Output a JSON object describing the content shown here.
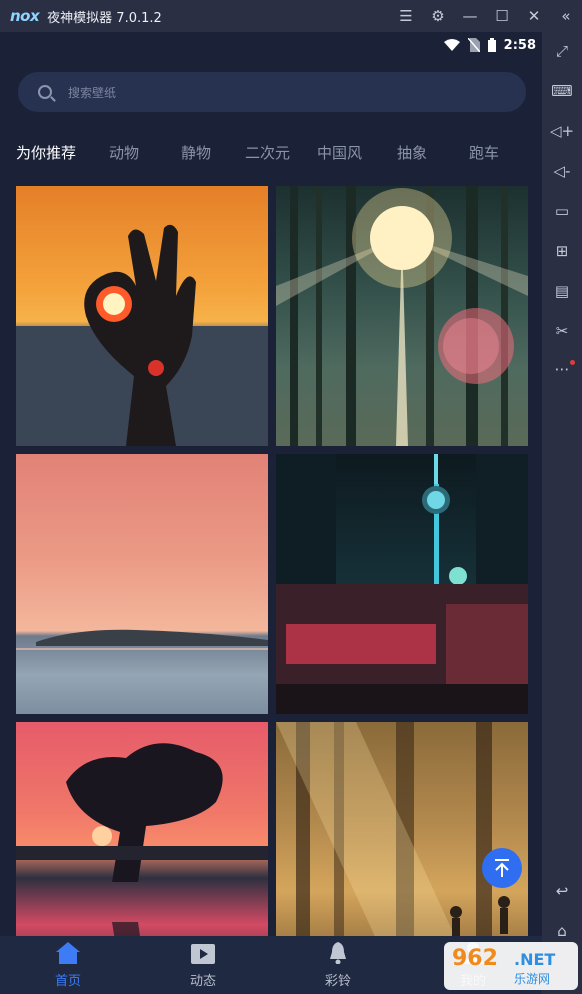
{
  "window": {
    "logo": "nox",
    "title": "夜神模拟器 7.0.1.2",
    "controls": [
      "menu-icon",
      "gear-icon",
      "minimize-icon",
      "maximize-icon",
      "close-icon",
      "collapse-icon"
    ]
  },
  "sidebar": {
    "items": [
      "fullscreen-icon",
      "keyboard-icon",
      "volume-up-icon",
      "volume-down-icon",
      "screen-icon",
      "apk-install-icon",
      "clear-cache-icon",
      "scissors-icon",
      "more-icon",
      "back-icon",
      "home-icon"
    ]
  },
  "status_bar": {
    "time": "2:58"
  },
  "search": {
    "placeholder": "搜索壁纸"
  },
  "categories": [
    {
      "label": "为你推荐",
      "active": true
    },
    {
      "label": "动物",
      "active": false
    },
    {
      "label": "静物",
      "active": false
    },
    {
      "label": "二次元",
      "active": false
    },
    {
      "label": "中国风",
      "active": false
    },
    {
      "label": "抽象",
      "active": false
    },
    {
      "label": "跑车",
      "active": false
    }
  ],
  "wallpapers": [
    "hand-ok-sunset",
    "forest-sunburst",
    "pink-sea-island",
    "oriental-pearl-tower-night",
    "tree-silhouette-sunset",
    "misty-forest-light"
  ],
  "bottom_nav": [
    {
      "label": "首页",
      "icon": "home-icon",
      "active": true
    },
    {
      "label": "动态",
      "icon": "video-icon",
      "active": false
    },
    {
      "label": "彩铃",
      "icon": "bell-icon",
      "active": false
    },
    {
      "label": "我的",
      "icon": "profile-icon",
      "active": false
    }
  ],
  "watermark": {
    "number": "962",
    "net": ".NET",
    "cn": "乐游网"
  },
  "colors": {
    "accent": "#3d7cf5",
    "background": "#1b2238",
    "fab": "#2f6ef0"
  }
}
